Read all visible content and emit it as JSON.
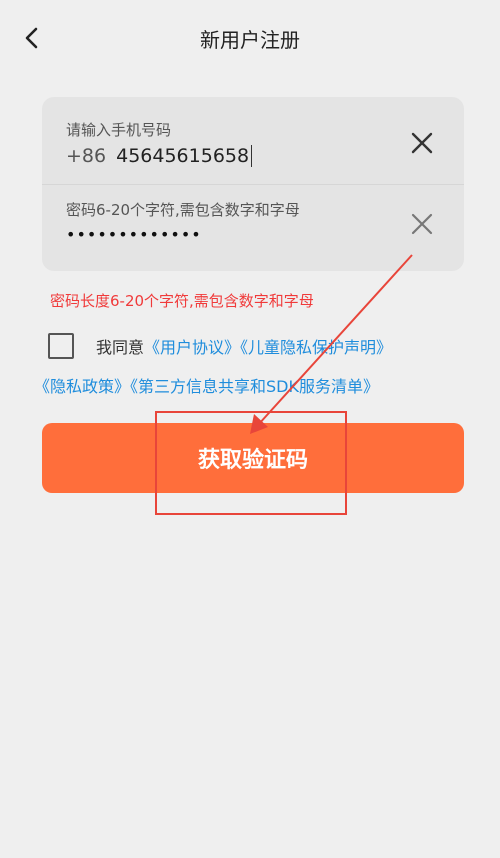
{
  "header": {
    "title": "新用户注册",
    "back_icon": "chevron-left-icon"
  },
  "form": {
    "phone": {
      "label": "请输入手机号码",
      "prefix": "+86",
      "value": "45645615658",
      "clear_icon": "close-icon"
    },
    "password": {
      "placeholder": "密码6-20个字符,需包含数字和字母",
      "value": "•••••••••••••",
      "clear_icon": "close-icon"
    }
  },
  "error_message": "密码长度6-20个字符,需包含数字和字母",
  "agreement": {
    "prefix": "我同意",
    "checked": false,
    "links": [
      "《用户协议》",
      "《儿童隐私保护声明》",
      "《隐私政策》",
      "《第三方信息共享和SDK服务清单》"
    ]
  },
  "submit_label": "获取验证码",
  "colors": {
    "background": "#efefef",
    "card": "#e4e4e4",
    "accent": "#ff6e3b",
    "error": "#f03a3a",
    "link": "#1f8ddc",
    "annotation": "#e8453a"
  }
}
